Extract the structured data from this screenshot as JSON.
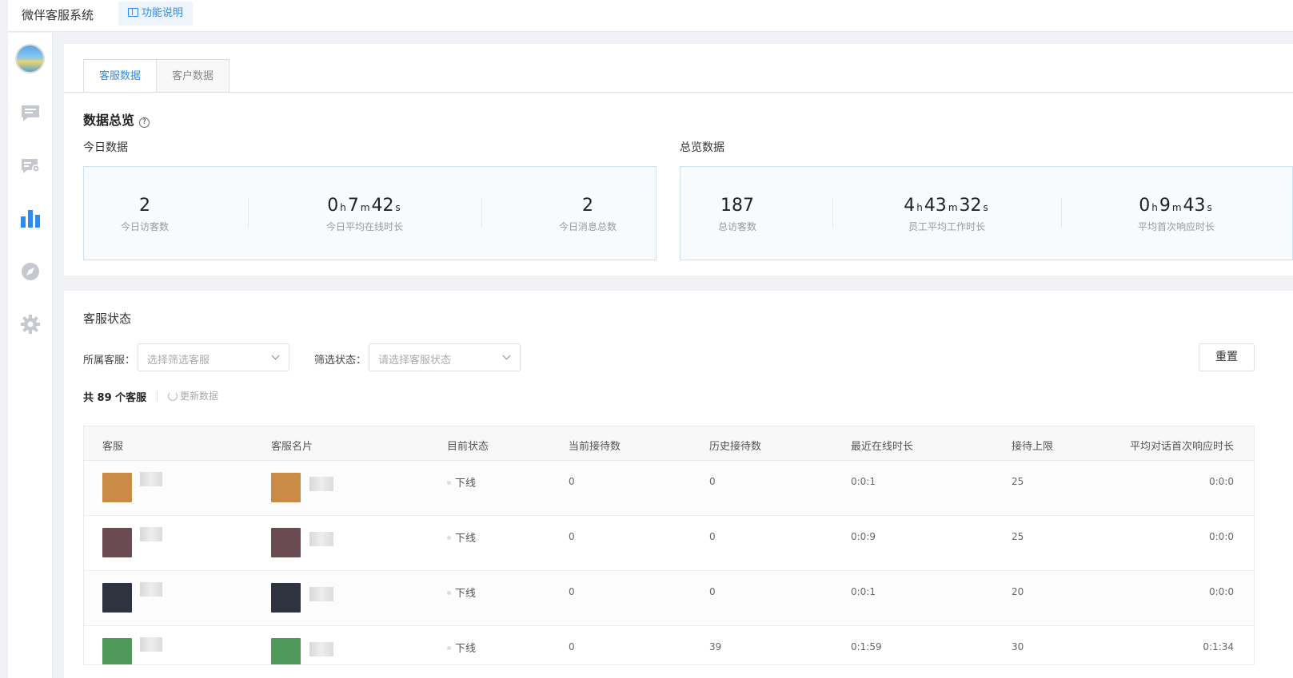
{
  "header": {
    "app_title": "微伴客服系统",
    "help_label": "功能说明"
  },
  "sidebar": {
    "items": [
      {
        "icon": "chat-icon",
        "active": false
      },
      {
        "icon": "chat-settings-icon",
        "active": false
      },
      {
        "icon": "bar-chart-icon",
        "active": true
      },
      {
        "icon": "compass-icon",
        "active": false
      },
      {
        "icon": "gear-icon",
        "active": false
      }
    ]
  },
  "tabs": [
    {
      "label": "客服数据",
      "active": true
    },
    {
      "label": "客户数据",
      "active": false
    }
  ],
  "overview": {
    "title": "数据总览",
    "today": {
      "label": "今日数据",
      "stats": [
        {
          "value": "2",
          "label": "今日访客数"
        },
        {
          "h": "0",
          "m": "7",
          "s": "42",
          "label": "今日平均在线时长"
        },
        {
          "value": "2",
          "label": "今日消息总数"
        }
      ]
    },
    "total": {
      "label": "总览数据",
      "stats": [
        {
          "value": "187",
          "label": "总访客数"
        },
        {
          "h": "4",
          "m": "43",
          "s": "32",
          "label": "员工平均工作时长"
        },
        {
          "h": "0",
          "m": "9",
          "s": "43",
          "label": "平均首次响应时长"
        }
      ]
    },
    "units": {
      "h": "h",
      "m": "m",
      "s": "s"
    }
  },
  "status": {
    "title": "客服状态",
    "filter_agent_label": "所属客服：",
    "filter_agent_placeholder": "选择筛选客服",
    "filter_status_label": "筛选状态：",
    "filter_status_placeholder": "请选择客服状态",
    "reset_label": "重置",
    "count_text": "共 89 个客服",
    "refresh_label": "更新数据"
  },
  "table": {
    "columns": [
      "客服",
      "客服名片",
      "目前状态",
      "当前接待数",
      "历史接待数",
      "最近在线时长",
      "接待上限",
      "平均对话首次响应时长"
    ],
    "rows": [
      {
        "status": "下线",
        "current": "0",
        "history": "0",
        "recent": "0:0:1",
        "limit": "25",
        "avg": "0:0:0",
        "avatar": "#c98b45"
      },
      {
        "status": "下线",
        "current": "0",
        "history": "0",
        "recent": "0:0:9",
        "limit": "25",
        "avg": "0:0:0",
        "avatar": "#6b4b52"
      },
      {
        "status": "下线",
        "current": "0",
        "history": "0",
        "recent": "0:0:1",
        "limit": "20",
        "avg": "0:0:0",
        "avatar": "#2f3340"
      },
      {
        "status": "下线",
        "current": "0",
        "history": "39",
        "recent": "0:1:59",
        "limit": "30",
        "avg": "0:1:34",
        "avatar": "#4f9a5a"
      }
    ]
  }
}
